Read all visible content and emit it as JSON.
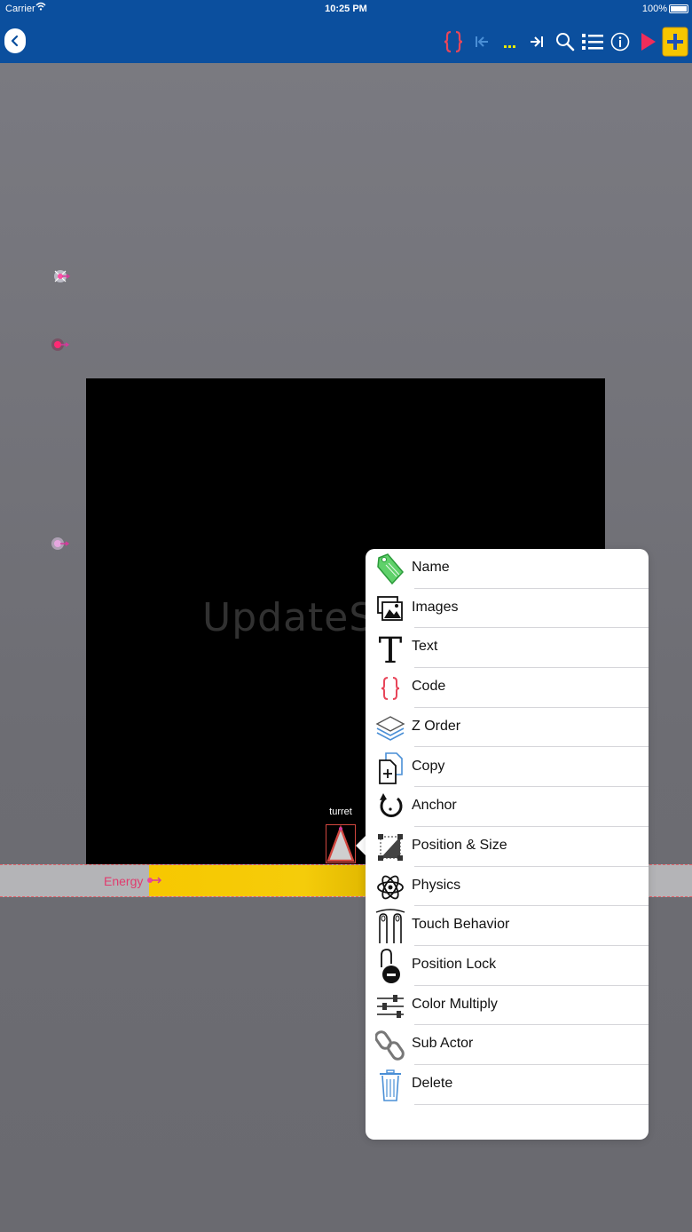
{
  "status_bar": {
    "carrier": "Carrier",
    "time": "10:25 PM",
    "battery": "100%"
  },
  "header": {
    "background": "#0b4f9e",
    "toolbar": [
      {
        "icon": "braces-icon",
        "color": "#e8465a"
      },
      {
        "icon": "jump-to-start-icon",
        "color": "#4a8fd6"
      },
      {
        "icon": "ellipsis-icon",
        "color": "#e7ea00"
      },
      {
        "icon": "jump-to-end-icon",
        "color": "#ffffff"
      },
      {
        "icon": "search-icon",
        "color": "#ffffff"
      },
      {
        "icon": "list-icon",
        "color": "#ffffff"
      },
      {
        "icon": "info-icon",
        "color": "#ffffff"
      },
      {
        "icon": "play-icon",
        "color": "#ee2d5a"
      },
      {
        "icon": "add-icon",
        "color": "#f7c600"
      }
    ]
  },
  "canvas": {
    "watermark": "UpdateStar.com",
    "energy_label": "Energy",
    "turret_label": "turret"
  },
  "menu": {
    "items": [
      {
        "label": "Name",
        "icon": "tag-icon"
      },
      {
        "label": "Images",
        "icon": "images-icon"
      },
      {
        "label": "Text",
        "icon": "text-icon"
      },
      {
        "label": "Code",
        "icon": "braces-icon"
      },
      {
        "label": "Z Order",
        "icon": "layers-icon"
      },
      {
        "label": "Copy",
        "icon": "copy-icon"
      },
      {
        "label": "Anchor",
        "icon": "anchor-rotate-icon"
      },
      {
        "label": "Position & Size",
        "icon": "position-size-icon"
      },
      {
        "label": "Physics",
        "icon": "atom-icon"
      },
      {
        "label": "Touch Behavior",
        "icon": "touch-icon"
      },
      {
        "label": "Position Lock",
        "icon": "lock-icon"
      },
      {
        "label": "Color Multiply",
        "icon": "sliders-icon"
      },
      {
        "label": "Sub Actor",
        "icon": "link-icon"
      },
      {
        "label": "Delete",
        "icon": "trash-icon"
      }
    ]
  }
}
